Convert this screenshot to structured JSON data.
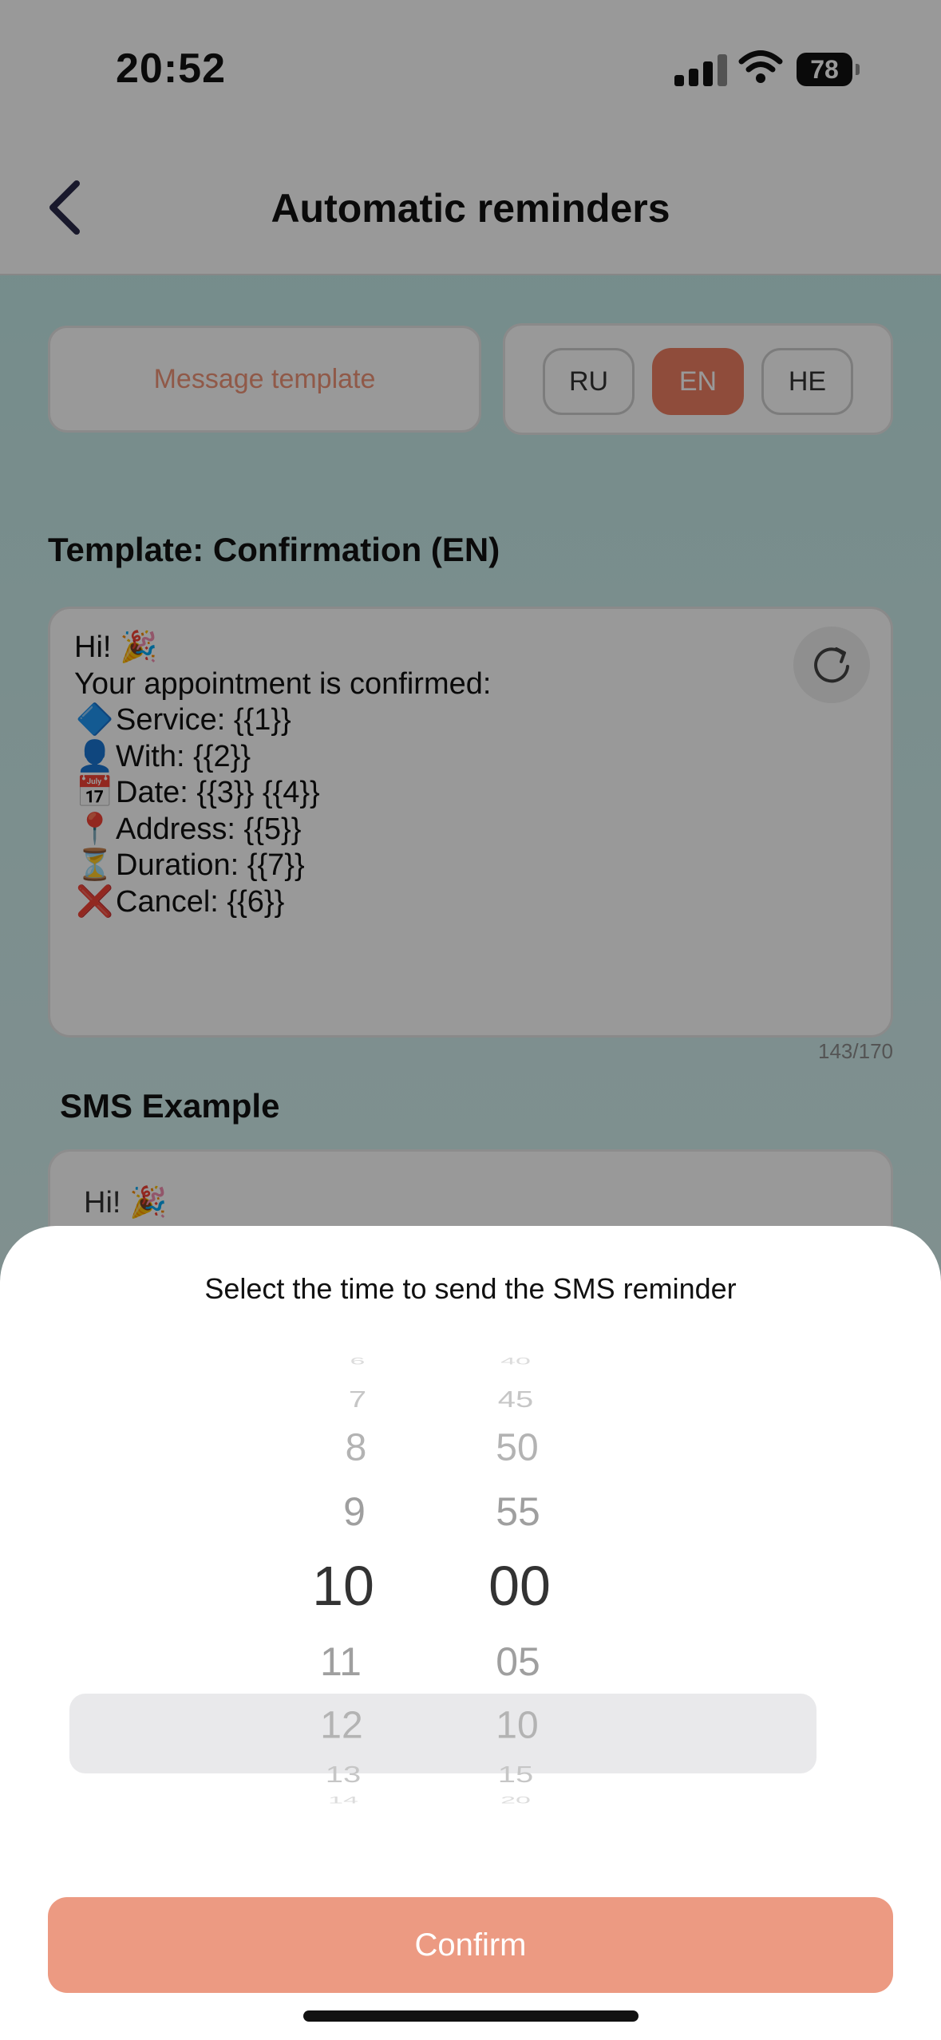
{
  "status_bar": {
    "time": "20:52",
    "battery": "78"
  },
  "nav": {
    "title": "Automatic reminders"
  },
  "template_button": {
    "label": "Message template"
  },
  "languages": [
    "RU",
    "EN",
    "HE"
  ],
  "active_language": "EN",
  "template": {
    "title": "Template: Confirmation (EN)",
    "lines": [
      {
        "icon": "",
        "text": "Hi! 🎉"
      },
      {
        "icon": "",
        "text": "Your appointment is confirmed:"
      },
      {
        "icon": "🔷",
        "text": "Service: {{1}}"
      },
      {
        "icon": "👤",
        "text": "With: {{2}}"
      },
      {
        "icon": "📅",
        "text": "Date: {{3}} {{4}}"
      },
      {
        "icon": "📍",
        "text": "Address: {{5}}"
      },
      {
        "icon": "⏳",
        "text": "Duration: {{7}}"
      },
      {
        "icon": "❌",
        "text": "Cancel: {{6}}"
      }
    ],
    "counter": "143/170"
  },
  "sms_example": {
    "title": "SMS Example",
    "preview": "Hi! 🎉"
  },
  "sheet": {
    "title": "Select the time to send the SMS reminder",
    "hours": [
      "6",
      "7",
      "8",
      "9",
      "10",
      "11",
      "12",
      "13",
      "14"
    ],
    "minutes": [
      "40",
      "45",
      "50",
      "55",
      "00",
      "05",
      "10",
      "15",
      "20"
    ],
    "selected_hour": "10",
    "selected_minute": "00",
    "confirm_label": "Confirm"
  },
  "colors": {
    "accent": "#ee7f63",
    "confirm": "#ec9a82",
    "template_text": "#f09478"
  }
}
